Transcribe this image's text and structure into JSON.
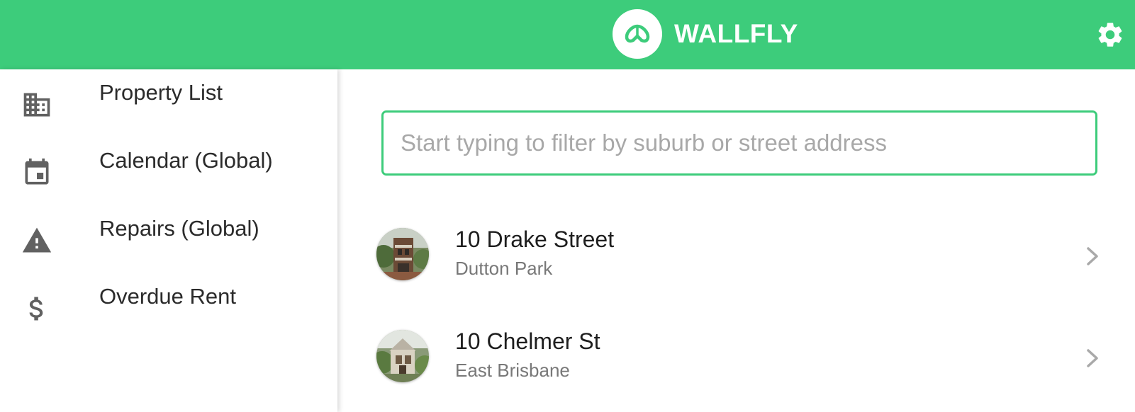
{
  "app": {
    "brand_name": "WALLFLY",
    "brand_color": "#3dcc7b",
    "logo_icon": "wallfly-logo",
    "settings_icon": "gear-icon"
  },
  "sidebar": {
    "items": [
      {
        "label": "Property List",
        "icon": "building-icon"
      },
      {
        "label": "Calendar (Global)",
        "icon": "calendar-icon"
      },
      {
        "label": "Repairs (Global)",
        "icon": "warning-icon"
      },
      {
        "label": "Overdue Rent",
        "icon": "dollar-icon"
      }
    ]
  },
  "search": {
    "placeholder": "Start typing to filter by suburb or street address",
    "value": ""
  },
  "properties": [
    {
      "street": "10 Drake Street",
      "suburb": "Dutton Park",
      "thumbnail": "property-photo"
    },
    {
      "street": "10 Chelmer St",
      "suburb": "East Brisbane",
      "thumbnail": "property-photo"
    }
  ]
}
